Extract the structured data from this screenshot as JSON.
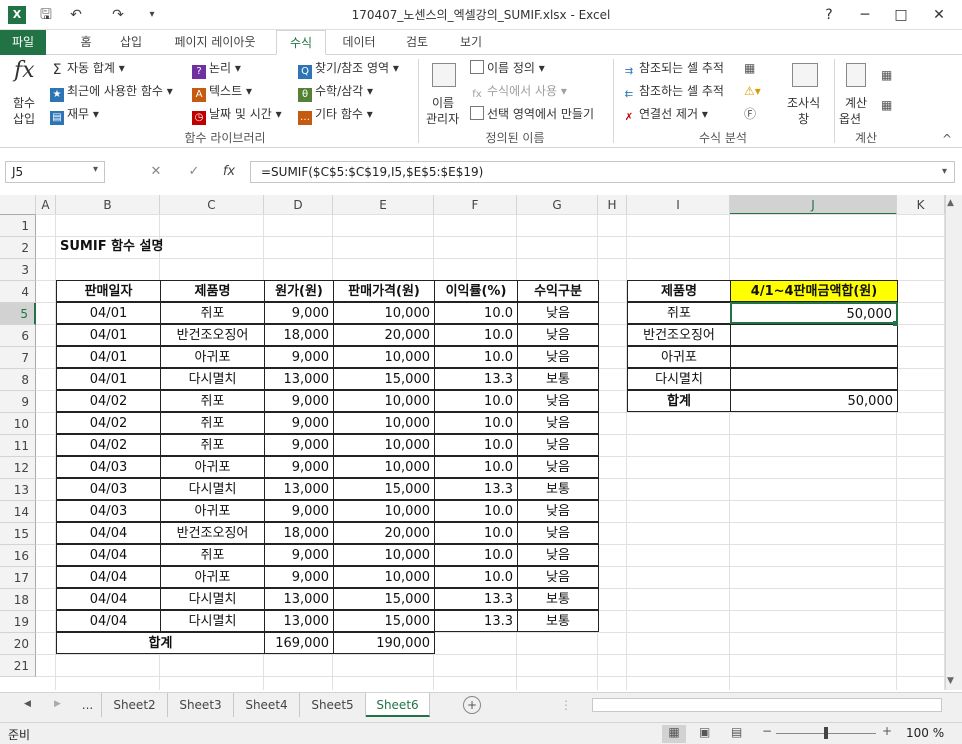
{
  "title": "170407_노센스의_엑셀강의_SUMIF.xlsx - Excel",
  "app_icon": "X",
  "window_controls": [
    "?",
    "─",
    "□",
    "✕"
  ],
  "tabs": [
    "파일",
    "홈",
    "삽입",
    "페이지 레이아웃",
    "수식",
    "데이터",
    "검토",
    "보기"
  ],
  "active_tab": "수식",
  "ribbon": {
    "insert_fn": [
      "함수",
      "삽입"
    ],
    "lib": {
      "autosum": "자동 합계",
      "recent": "최근에 사용한 함수",
      "finance": "재무",
      "logic": "논리",
      "text": "텍스트",
      "datetime": "날짜 및 시간",
      "lookup": "찾기/참조 영역",
      "math": "수학/삼각",
      "more": "기타 함수",
      "group": "함수 라이브러리"
    },
    "names": {
      "manager": [
        "이름",
        "관리자"
      ],
      "define": "이름 정의",
      "use": "수식에서 사용",
      "create": "선택 영역에서 만들기",
      "group": "정의된 이름"
    },
    "audit": {
      "precedents": "참조되는 셀 추적",
      "dependents": "참조하는 셀 추적",
      "remove": "연결선 제거",
      "watch": [
        "조사식",
        "창"
      ],
      "group": "수식 분석"
    },
    "calc": {
      "options": [
        "계산",
        "옵션"
      ],
      "group": "계산"
    }
  },
  "name_box": "J5",
  "formula": "=SUMIF($C$5:$C$19,I5,$E$5:$E$19)",
  "columns": [
    "A",
    "B",
    "C",
    "D",
    "E",
    "F",
    "G",
    "H",
    "I",
    "J",
    "K"
  ],
  "rows": [
    "1",
    "2",
    "3",
    "4",
    "5",
    "6",
    "7",
    "8",
    "9",
    "10",
    "11",
    "12",
    "13",
    "14",
    "15",
    "16",
    "17",
    "18",
    "19",
    "20",
    "21"
  ],
  "sheet_title": "SUMIF 함수 설명",
  "table_headers": [
    "판매일자",
    "제품명",
    "원가(원)",
    "판매가격(원)",
    "이익률(%)",
    "수익구분"
  ],
  "table_rows": [
    [
      "04/01",
      "쥐포",
      "9,000",
      "10,000",
      "10.0",
      "낮음"
    ],
    [
      "04/01",
      "반건조오징어",
      "18,000",
      "20,000",
      "10.0",
      "낮음"
    ],
    [
      "04/01",
      "아귀포",
      "9,000",
      "10,000",
      "10.0",
      "낮음"
    ],
    [
      "04/01",
      "다시멸치",
      "13,000",
      "15,000",
      "13.3",
      "보통"
    ],
    [
      "04/02",
      "쥐포",
      "9,000",
      "10,000",
      "10.0",
      "낮음"
    ],
    [
      "04/02",
      "쥐포",
      "9,000",
      "10,000",
      "10.0",
      "낮음"
    ],
    [
      "04/02",
      "쥐포",
      "9,000",
      "10,000",
      "10.0",
      "낮음"
    ],
    [
      "04/03",
      "아귀포",
      "9,000",
      "10,000",
      "10.0",
      "낮음"
    ],
    [
      "04/03",
      "다시멸치",
      "13,000",
      "15,000",
      "13.3",
      "보통"
    ],
    [
      "04/03",
      "아귀포",
      "9,000",
      "10,000",
      "10.0",
      "낮음"
    ],
    [
      "04/04",
      "반건조오징어",
      "18,000",
      "20,000",
      "10.0",
      "낮음"
    ],
    [
      "04/04",
      "쥐포",
      "9,000",
      "10,000",
      "10.0",
      "낮음"
    ],
    [
      "04/04",
      "아귀포",
      "9,000",
      "10,000",
      "10.0",
      "낮음"
    ],
    [
      "04/04",
      "다시멸치",
      "13,000",
      "15,000",
      "13.3",
      "보통"
    ],
    [
      "04/04",
      "다시멸치",
      "13,000",
      "15,000",
      "13.3",
      "보통"
    ]
  ],
  "total_row": {
    "label": "합계",
    "cost": "169,000",
    "price": "190,000"
  },
  "summary_headers": [
    "제품명",
    "4/1~4판매금액합(원)"
  ],
  "summary_rows": [
    [
      "쥐포",
      "50,000"
    ],
    [
      "반건조오징어",
      ""
    ],
    [
      "아귀포",
      ""
    ],
    [
      "다시멸치",
      ""
    ]
  ],
  "summary_total": {
    "label": "합계",
    "value": "50,000"
  },
  "highlight_color": "#ffff00",
  "sheet_tabs": [
    "...",
    "Sheet2",
    "Sheet3",
    "Sheet4",
    "Sheet5",
    "Sheet6"
  ],
  "active_sheet": "Sheet6",
  "status": {
    "ready": "준비",
    "zoom": "100 %"
  }
}
